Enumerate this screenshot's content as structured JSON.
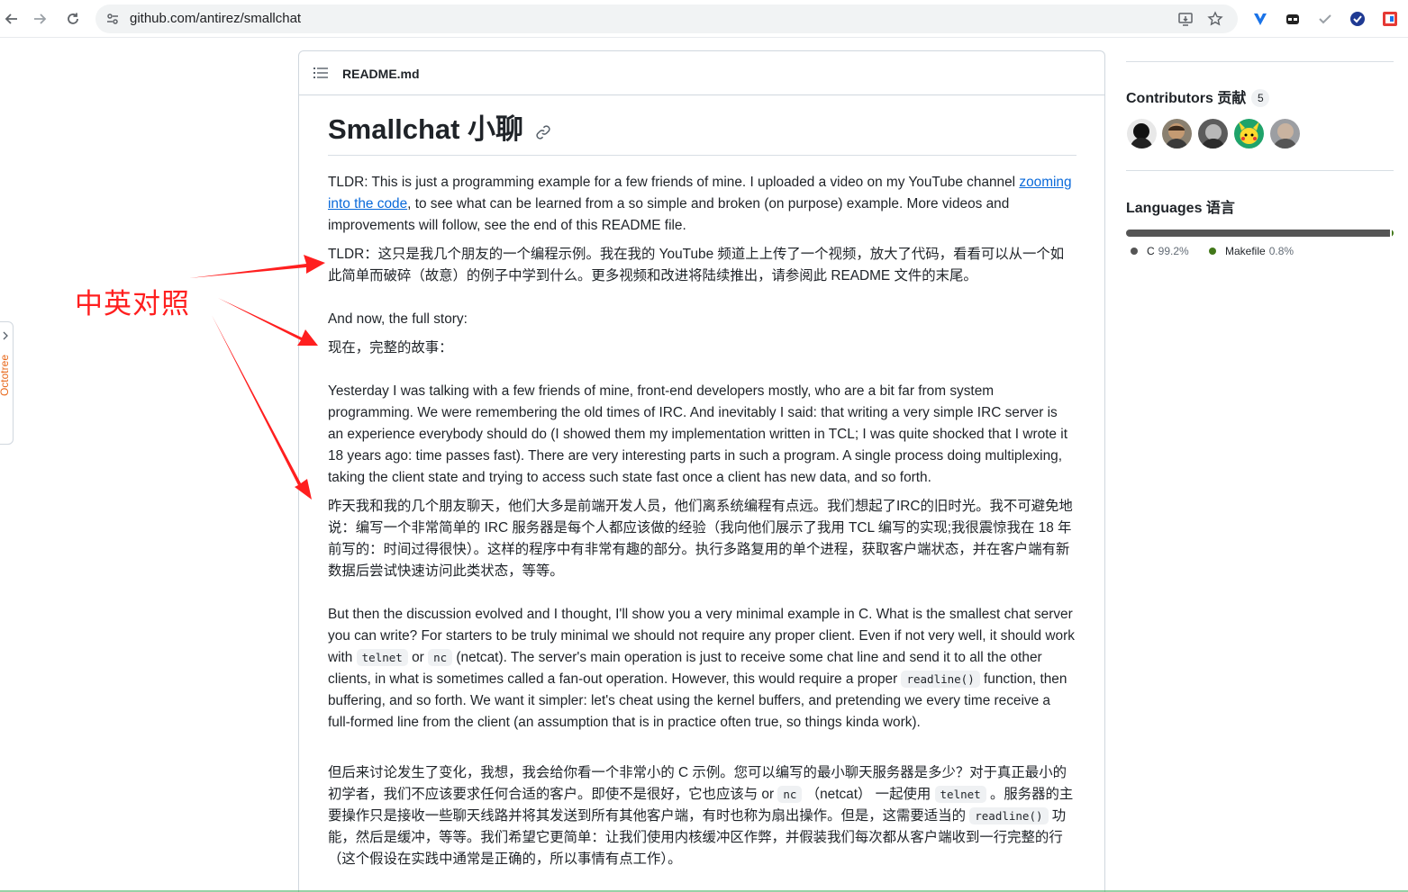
{
  "browser": {
    "url": "github.com/antirez/smallchat"
  },
  "readme": {
    "filename": "README.md",
    "title": "Smallchat 小聊",
    "paragraphs": {
      "p1_before": "TLDR: This is just a programming example for a few friends of mine. I uploaded a video on my YouTube channel ",
      "p1_link": "zooming into the code",
      "p1_after": ", to see what can be learned from a so simple and broken (on purpose) example. More videos and improvements will follow, see the end of this README file.",
      "p1_zh": "TLDR：这只是我几个朋友的一个编程示例。我在我的 YouTube 频道上上传了一个视频，放大了代码，看看可以从一个如此简单而破碎（故意）的例子中学到什么。更多视频和改进将陆续推出，请参阅此 README 文件的末尾。",
      "p2": "And now, the full story:",
      "p2_zh": "现在，完整的故事：",
      "p3": "Yesterday I was talking with a few friends of mine, front-end developers mostly, who are a bit far from system programming. We were remembering the old times of IRC. And inevitably I said: that writing a very simple IRC server is an experience everybody should do (I showed them my implementation written in TCL; I was quite shocked that I wrote it 18 years ago: time passes fast). There are very interesting parts in such a program. A single process doing multiplexing, taking the client state and trying to access such state fast once a client has new data, and so forth.",
      "p3_zh": "昨天我和我的几个朋友聊天，他们大多是前端开发人员，他们离系统编程有点远。我们想起了IRC的旧时光。我不可避免地说：编写一个非常简单的 IRC 服务器是每个人都应该做的经验（我向他们展示了我用 TCL 编写的实现;我很震惊我在 18 年前写的：时间过得很快）。这样的程序中有非常有趣的部分。执行多路复用的单个进程，获取客户端状态，并在客户端有新数据后尝试快速访问此类状态，等等。",
      "p4_a": "But then the discussion evolved and I thought, I'll show you a very minimal example in C. What is the smallest chat server you can write? For starters to be truly minimal we should not require any proper client. Even if not very well, it should work with ",
      "p4_code1": "telnet",
      "p4_b": " or ",
      "p4_code2": "nc",
      "p4_c": " (netcat). The server's main operation is just to receive some chat line and send it to all the other clients, in what is sometimes called a fan-out operation. However, this would require a proper ",
      "p4_code3": "readline()",
      "p4_d": " function, then buffering, and so forth. We want it simpler: let's cheat using the kernel buffers, and pretending we every time receive a full-formed line from the client (an assumption that is in practice often true, so things kinda work).",
      "p4_zh_a": "但后来讨论发生了变化，我想，我会给你看一个非常小的 C 示例。您可以编写的最小聊天服务器是多少？对于真正最小的初学者，我们不应该要求任何合适的客户。即使不是很好，它也应该与 or ",
      "p4_zh_code1": "nc",
      "p4_zh_b": " （netcat） 一起使用 ",
      "p4_zh_code2": "telnet",
      "p4_zh_c": " 。服务器的主要操作只是接收一些聊天线路并将其发送到所有其他客户端，有时也称为扇出操作。但是，这需要适当的 ",
      "p4_zh_code3": "readline()",
      "p4_zh_d": " 功能，然后是缓冲，等等。我们希望它更简单：让我们使用内核缓冲区作弊，并假装我们每次都从客户端收到一行完整的行（这个假设在实践中通常是正确的，所以事情有点工作）。"
    }
  },
  "sidebar": {
    "contributors_label": "Contributors 贡献",
    "contributors_count": "5",
    "languages_label": "Languages 语言",
    "languages": [
      {
        "name": "C",
        "pct": "99.2%",
        "value": 99.2,
        "color": "#555555"
      },
      {
        "name": "Makefile",
        "pct": "0.8%",
        "value": 0.8,
        "color": "#427819"
      }
    ]
  },
  "octotree_label": "Octotree",
  "annotation": {
    "text": "中英对照",
    "color": "#ff1f1f"
  }
}
